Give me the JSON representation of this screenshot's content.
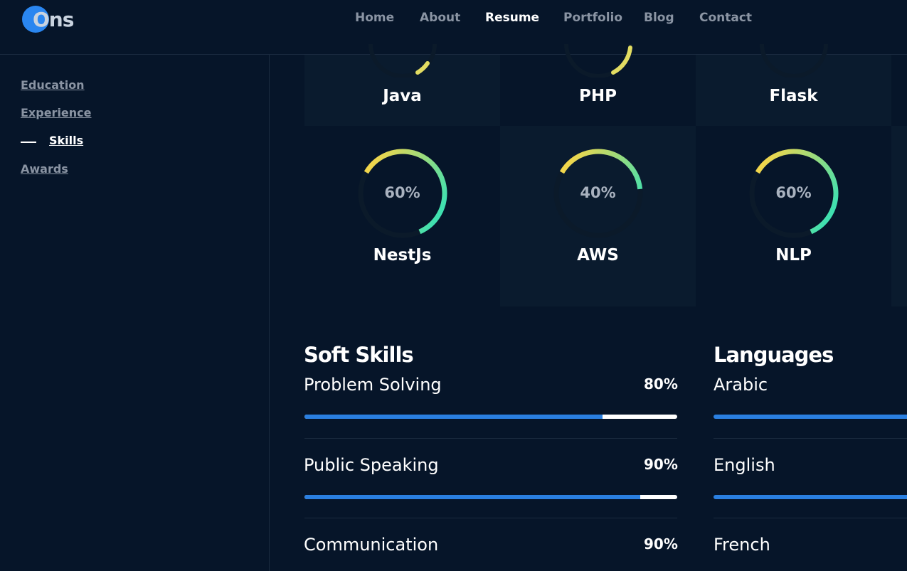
{
  "brand": {
    "logo_text": "Ons",
    "accent": "#2a86f0"
  },
  "nav": {
    "items": [
      {
        "label": "Home"
      },
      {
        "label": "About"
      },
      {
        "label": "Resume",
        "active": true
      },
      {
        "label": "Portfolio"
      },
      {
        "label": "Blog"
      },
      {
        "label": "Contact"
      }
    ]
  },
  "sidebar": {
    "items": [
      {
        "label": "Education"
      },
      {
        "label": "Experience"
      },
      {
        "label": "Skills",
        "active": true
      },
      {
        "label": "Awards"
      }
    ]
  },
  "tech_skills": {
    "top_row": [
      {
        "name": "Java"
      },
      {
        "name": "PHP"
      },
      {
        "name": "Flask"
      }
    ],
    "second_row": [
      {
        "name": "NestJs",
        "percent_label": "60%",
        "level": 0.6
      },
      {
        "name": "AWS",
        "percent_label": "40%",
        "level": 0.4
      },
      {
        "name": "NLP",
        "percent_label": "60%",
        "level": 0.6
      }
    ]
  },
  "soft_skills": {
    "title": "Soft Skills",
    "items": [
      {
        "name": "Problem Solving",
        "percent_label": "80%",
        "level": 0.8
      },
      {
        "name": "Public Speaking",
        "percent_label": "90%",
        "level": 0.9
      },
      {
        "name": "Communication",
        "percent_label": "90%",
        "level": 0.9
      }
    ]
  },
  "languages": {
    "title": "Languages",
    "items": [
      {
        "name": "Arabic"
      },
      {
        "name": "English"
      },
      {
        "name": "French"
      }
    ]
  },
  "colors": {
    "background": "#061529",
    "tile_shade": "#0a1b2e",
    "bar_fill": "#2a7fe0",
    "gauge_start": "#3fe0b0",
    "gauge_end": "#f2d64b",
    "gauge_track": "#0b1a2a"
  }
}
